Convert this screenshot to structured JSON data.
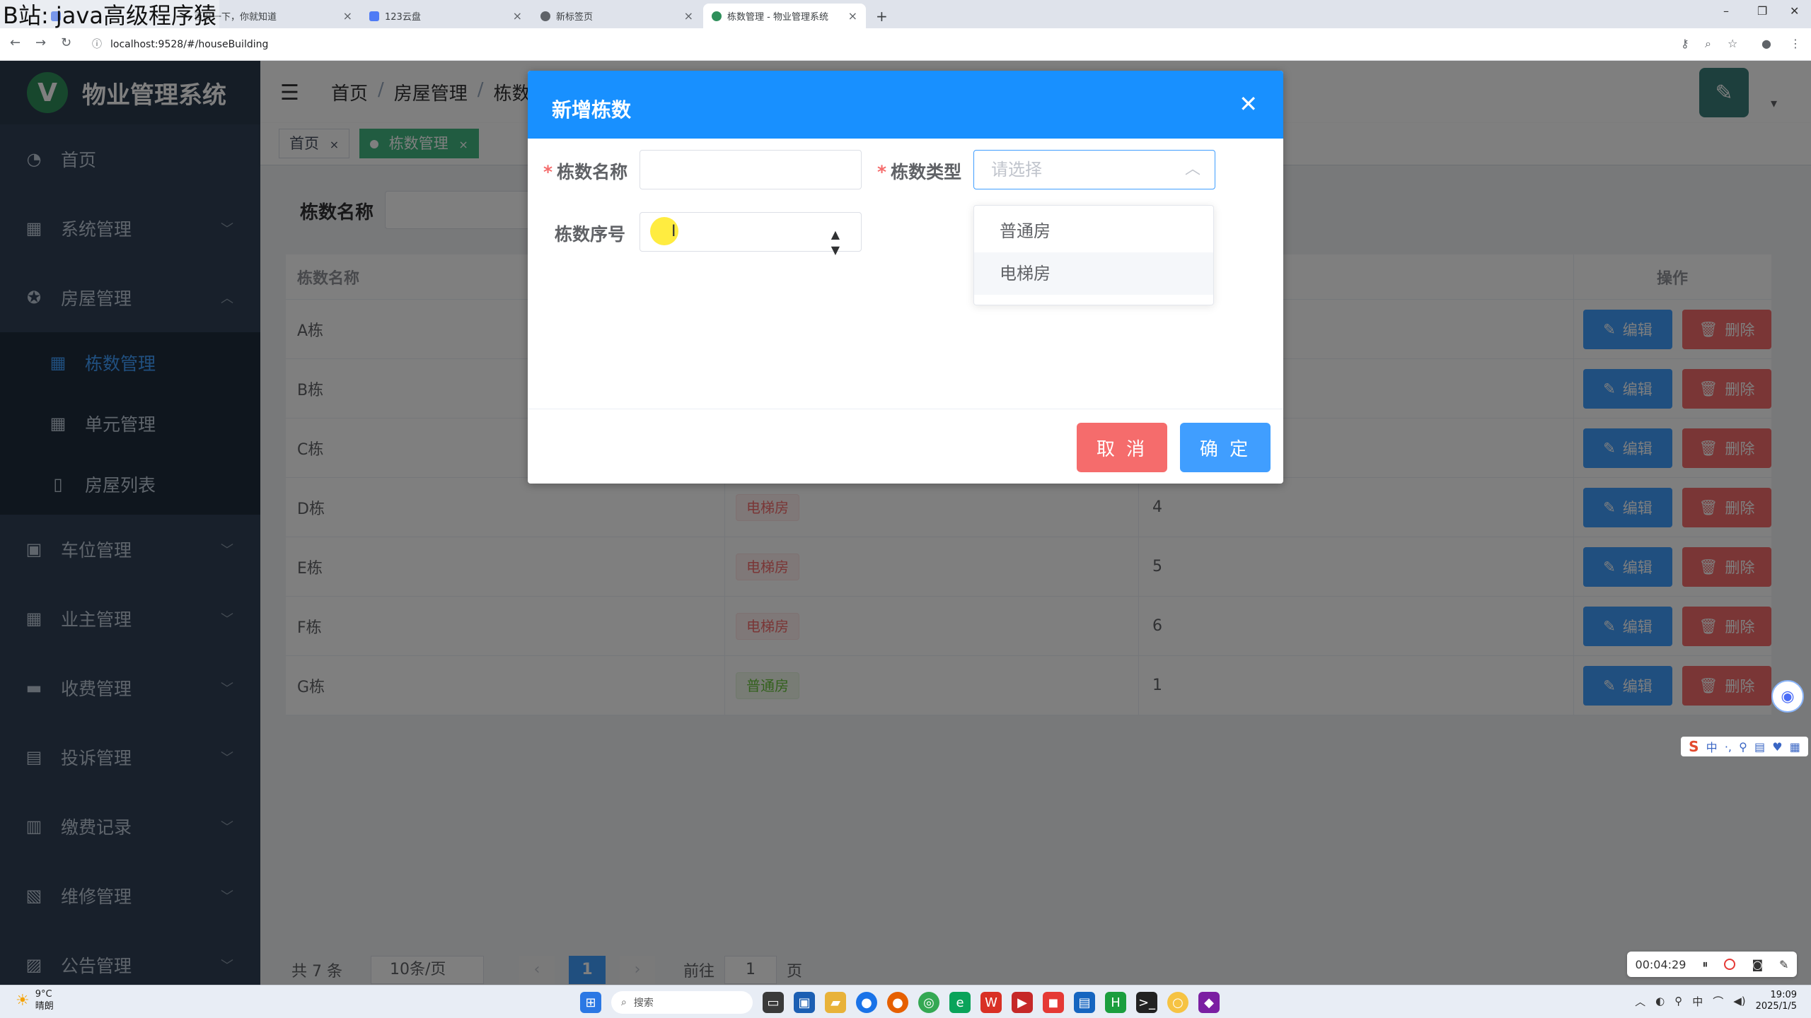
{
  "watermark": "B站: java高级程序猿",
  "browser": {
    "tabs": [
      {
        "title": "百度一下，你就知道",
        "active": false
      },
      {
        "title": "123云盘",
        "active": false
      },
      {
        "title": "新标签页",
        "active": false
      },
      {
        "title": "栋数管理 - 物业管理系统",
        "active": true
      }
    ],
    "new_tab": "+",
    "url": "localhost:9528/#/houseBuilding"
  },
  "sidebar": {
    "logo_letter": "V",
    "title": "物业管理系统",
    "items": [
      {
        "label": "首页",
        "icon": "dashboard-icon"
      },
      {
        "label": "系统管理",
        "icon": "grid-icon"
      },
      {
        "label": "房屋管理",
        "icon": "house-icon",
        "expanded": true
      },
      {
        "label": "车位管理",
        "icon": "parking-icon"
      },
      {
        "label": "业主管理",
        "icon": "table-icon"
      },
      {
        "label": "收费管理",
        "icon": "brush-icon"
      },
      {
        "label": "投诉管理",
        "icon": "calendar-icon"
      },
      {
        "label": "缴费记录",
        "icon": "chart-icon"
      },
      {
        "label": "维修管理",
        "icon": "picture-icon"
      },
      {
        "label": "公告管理",
        "icon": "notice-icon"
      }
    ],
    "subitems": [
      {
        "label": "栋数管理",
        "active": true
      },
      {
        "label": "单元管理",
        "active": false
      },
      {
        "label": "房屋列表",
        "active": false
      }
    ]
  },
  "navbar": {
    "breadcrumb": [
      "首页",
      "房屋管理",
      "栋数"
    ]
  },
  "tags": [
    {
      "label": "首页",
      "active": false
    },
    {
      "label": "栋数管理",
      "active": true
    }
  ],
  "search": {
    "label": "栋数名称"
  },
  "table": {
    "headers": [
      "栋数名称",
      "",
      "",
      "操作"
    ],
    "rows": [
      {
        "name": "A栋",
        "type": "",
        "order": ""
      },
      {
        "name": "B栋",
        "type": "",
        "order": ""
      },
      {
        "name": "C栋",
        "type": "",
        "order": ""
      },
      {
        "name": "D栋",
        "type": "电梯房",
        "order": "4"
      },
      {
        "name": "E栋",
        "type": "电梯房",
        "order": "5"
      },
      {
        "name": "F栋",
        "type": "电梯房",
        "order": "6"
      },
      {
        "name": "G栋",
        "type": "普通房",
        "order": "1"
      }
    ],
    "edit_label": "编辑",
    "delete_label": "删除"
  },
  "pagination": {
    "total": "共 7 条",
    "page_size": "10条/页",
    "current": "1",
    "goto_prefix": "前往",
    "goto_value": "1",
    "goto_suffix": "页"
  },
  "dialog": {
    "title": "新增栋数",
    "name_label": "栋数名称",
    "type_label": "栋数类型",
    "type_placeholder": "请选择",
    "order_label": "栋数序号",
    "cancel": "取 消",
    "confirm": "确 定",
    "type_options": [
      "普通房",
      "电梯房"
    ]
  },
  "recorder": {
    "time": "00:04:29"
  },
  "taskbar": {
    "weather_temp": "9°C",
    "weather_desc": "晴朗",
    "search": "搜索",
    "time": "19:09",
    "date": "2025/1/5"
  },
  "colors": {
    "primary": "#409eff",
    "danger": "#f56c6c",
    "success": "#42b983",
    "sidebar": "#304156",
    "dialog_header": "#1890ff"
  }
}
